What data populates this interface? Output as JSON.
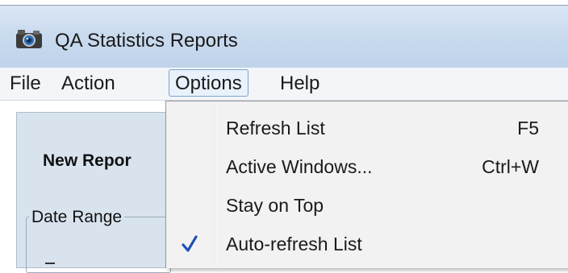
{
  "window": {
    "title": "QA Statistics Reports",
    "icon": "camera-icon"
  },
  "menubar": {
    "items": [
      {
        "label": "File"
      },
      {
        "label": "Action"
      },
      {
        "label": "Options"
      },
      {
        "label": "Help"
      }
    ],
    "open_item": "Options"
  },
  "options_menu": {
    "items": [
      {
        "label": "Refresh List",
        "shortcut": "F5",
        "checked": false
      },
      {
        "label": "Active Windows...",
        "shortcut": "Ctrl+W",
        "checked": false
      },
      {
        "label": "Stay on Top",
        "shortcut": "",
        "checked": false
      },
      {
        "label": "Auto-refresh List",
        "shortcut": "",
        "checked": true
      }
    ]
  },
  "panel": {
    "new_report_label": "New Repor",
    "date_range_label": "Date Range"
  },
  "colors": {
    "titlebar": "#c8d9ee",
    "menubar": "#f3f5f9",
    "menu_highlight_border": "#7da2ce",
    "dropdown_bg": "#f2f2f2",
    "panel_bg": "#d9e3ee",
    "check_mark": "#1f4fb5"
  }
}
